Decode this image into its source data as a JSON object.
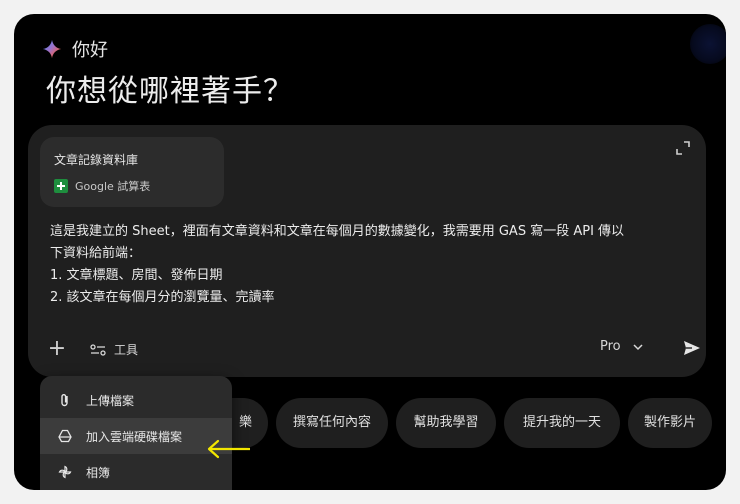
{
  "greeting": {
    "small": "你好",
    "large": "你想從哪裡著手？"
  },
  "attachment": {
    "title": "文章記錄資料庫",
    "source": "Google 試算表"
  },
  "prompt": {
    "lines": [
      "這是我建立的 Sheet，裡面有文章資料和文章在每個月的數據變化，我需要用 GAS 寫一段 API 傳以",
      "下資料給前端：",
      "1. 文章標題、房間、發佈日期",
      "2. 該文章在每個月分的瀏覽量、完讀率"
    ]
  },
  "toolbar": {
    "tools_label": "工具",
    "model_label": "Pro"
  },
  "chips": [
    "樂",
    "撰寫任何內容",
    "幫助我學習",
    "提升我的一天",
    "製作影片"
  ],
  "menu": {
    "items": [
      {
        "label": "上傳檔案",
        "icon": "paperclip-icon"
      },
      {
        "label": "加入雲端硬碟檔案",
        "icon": "drive-icon"
      },
      {
        "label": "相簿",
        "icon": "photos-pinwheel-icon"
      }
    ]
  },
  "colors": {
    "background": "#000000",
    "card": "#1f1f1f",
    "annotation_arrow": "#f2e600"
  }
}
